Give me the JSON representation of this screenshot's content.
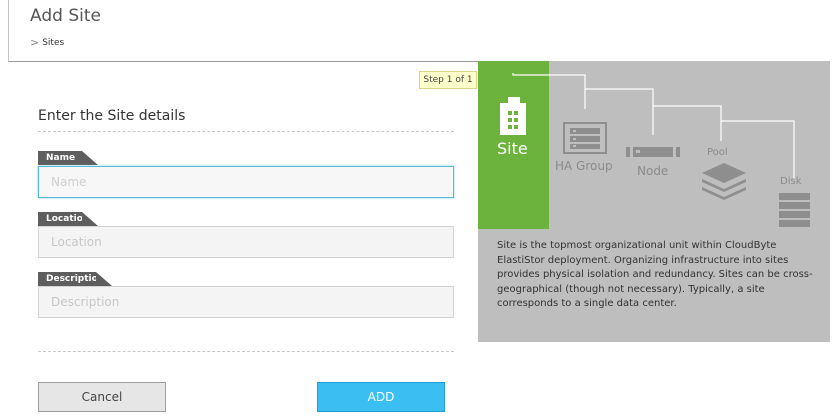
{
  "header": {
    "title": "Add Site",
    "breadcrumb": {
      "separator": ">",
      "current": "Sites"
    }
  },
  "wizard": {
    "step_label": "Step 1 of 1"
  },
  "form": {
    "heading": "Enter the Site details",
    "fields": [
      {
        "tag": "Name",
        "placeholder": "Name",
        "value": ""
      },
      {
        "tag": "Location",
        "placeholder": "Location",
        "value": ""
      },
      {
        "tag": "Description",
        "placeholder": "Description",
        "value": ""
      }
    ],
    "cancel_label": "Cancel",
    "add_label": "ADD"
  },
  "hierarchy": {
    "nodes": [
      {
        "label": "Site",
        "icon": "building-icon",
        "active": true
      },
      {
        "label": "HA Group",
        "icon": "server-rack-icon",
        "active": false
      },
      {
        "label": "Node",
        "icon": "server-node-icon",
        "active": false
      },
      {
        "label": "Pool",
        "icon": "layers-icon",
        "active": false
      },
      {
        "label": "Disk",
        "icon": "disk-stack-icon",
        "active": false
      }
    ],
    "description": "Site is the topmost organizational unit within CloudByte ElastiStor deployment. Organizing infrastructure into sites provides physical isolation and redundancy. Sites can be cross-geographical (though not necessary). Typically, a site corresponds to a single data center."
  },
  "colors": {
    "accent_green": "#6cb33e",
    "add_button": "#3bbff2",
    "panel_gray": "#bebebe",
    "tag_dark": "#5e5e5e",
    "focus_border": "#5bb6d8"
  }
}
